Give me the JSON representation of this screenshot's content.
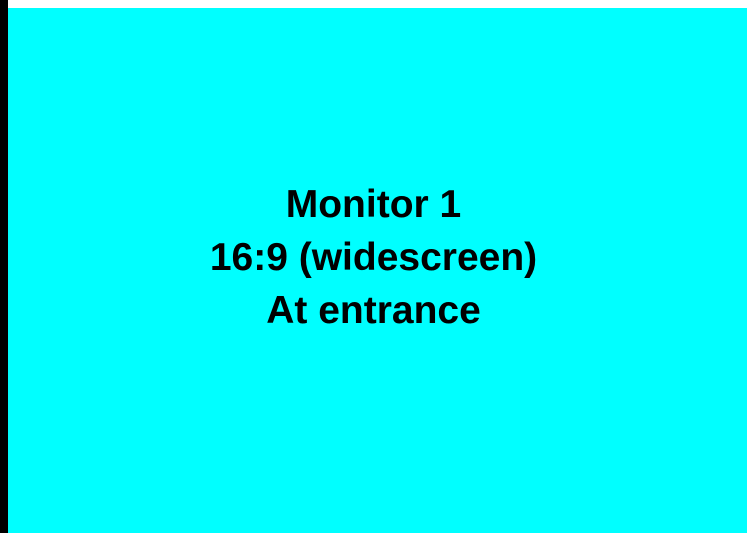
{
  "colors": {
    "background": "#00FFFF",
    "frame": "#000000",
    "text": "#000000"
  },
  "monitor": {
    "title": "Monitor 1",
    "aspect": "16:9 (widescreen)",
    "location": "At entrance"
  }
}
